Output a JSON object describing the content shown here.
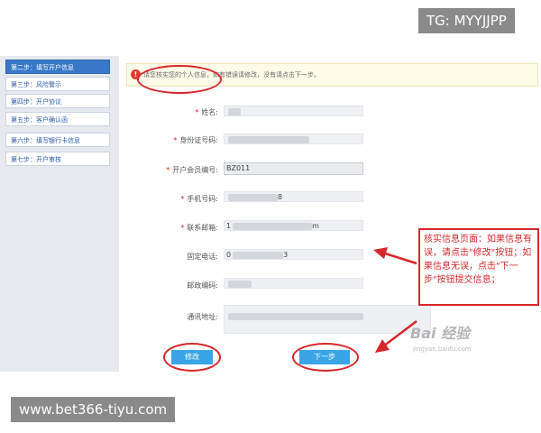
{
  "sidebar": {
    "items": [
      {
        "label": "第二步：填写开户信息",
        "active": true
      },
      {
        "label": "第三步：风险警示",
        "active": false
      },
      {
        "label": "第四步：开户协议",
        "active": false
      },
      {
        "label": "第五步：客户确认函",
        "active": false
      },
      {
        "label": "第六步：填写银行卡信息",
        "active": false
      },
      {
        "label": "第七步：开户审核",
        "active": false
      }
    ]
  },
  "notice": {
    "icon": "!",
    "text": "请您核实您的个人信息，如有错误请修改，没有请点击下一步。"
  },
  "form": {
    "required_mark": "*",
    "fields": [
      {
        "label": "姓名:",
        "required": true,
        "value": ""
      },
      {
        "label": "身份证号码:",
        "required": true,
        "value": ""
      },
      {
        "label": "开户会员编号:",
        "required": true,
        "value": "BZ011"
      },
      {
        "label": "手机号码:",
        "required": true,
        "value": "8"
      },
      {
        "label": "联系邮箱:",
        "required": true,
        "value": "1",
        "suffix": "m"
      },
      {
        "label": "固定电话:",
        "required": false,
        "value": "0",
        "suffix": "3"
      },
      {
        "label": "邮政编码:",
        "required": false,
        "value": ""
      },
      {
        "label": "通讯地址:",
        "required": false,
        "value": ""
      }
    ]
  },
  "buttons": {
    "modify_label": "修改",
    "next_label": "下一步"
  },
  "annotation": {
    "text": "核实信息页面：如果信息有误，请点击\"修改\"按钮；如果信息无误，点击\"下一步\"按钮提交信息；"
  },
  "watermarks": {
    "top_right": "TG: MYYJJPP",
    "bottom_left": "www.bet366-tiyu.com",
    "baidu": "Bai 经验",
    "baidu_sub": "jingyan.baidu.com"
  },
  "colors": {
    "accent": "#39a5e6",
    "annotation_red": "#d6272c",
    "sidebar_active": "#3978c8"
  }
}
